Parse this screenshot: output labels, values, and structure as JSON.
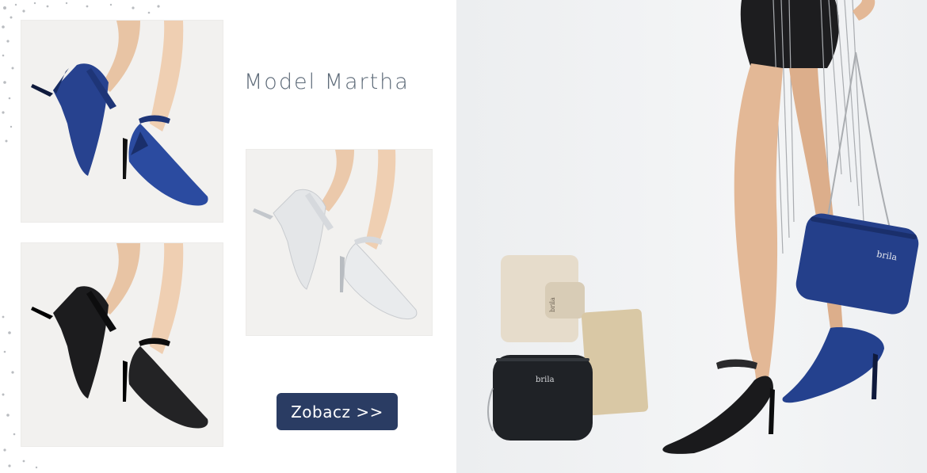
{
  "banner": {
    "title": "Model Martha",
    "cta_label": "Zobacz >>"
  },
  "product_images": [
    {
      "color": "navy-metallic",
      "hex": "#27428f"
    },
    {
      "color": "silver",
      "hex": "#e4e6e8"
    },
    {
      "color": "black",
      "hex": "#1c1c1e"
    }
  ],
  "hero": {
    "bag_brand": "brila",
    "accessories": [
      "gold-wallet",
      "gold-clutch",
      "black-crossbody-bag",
      "navy-crossbody-bag"
    ]
  },
  "colors": {
    "accent": "#2a3c63",
    "title": "#5d6a78"
  }
}
